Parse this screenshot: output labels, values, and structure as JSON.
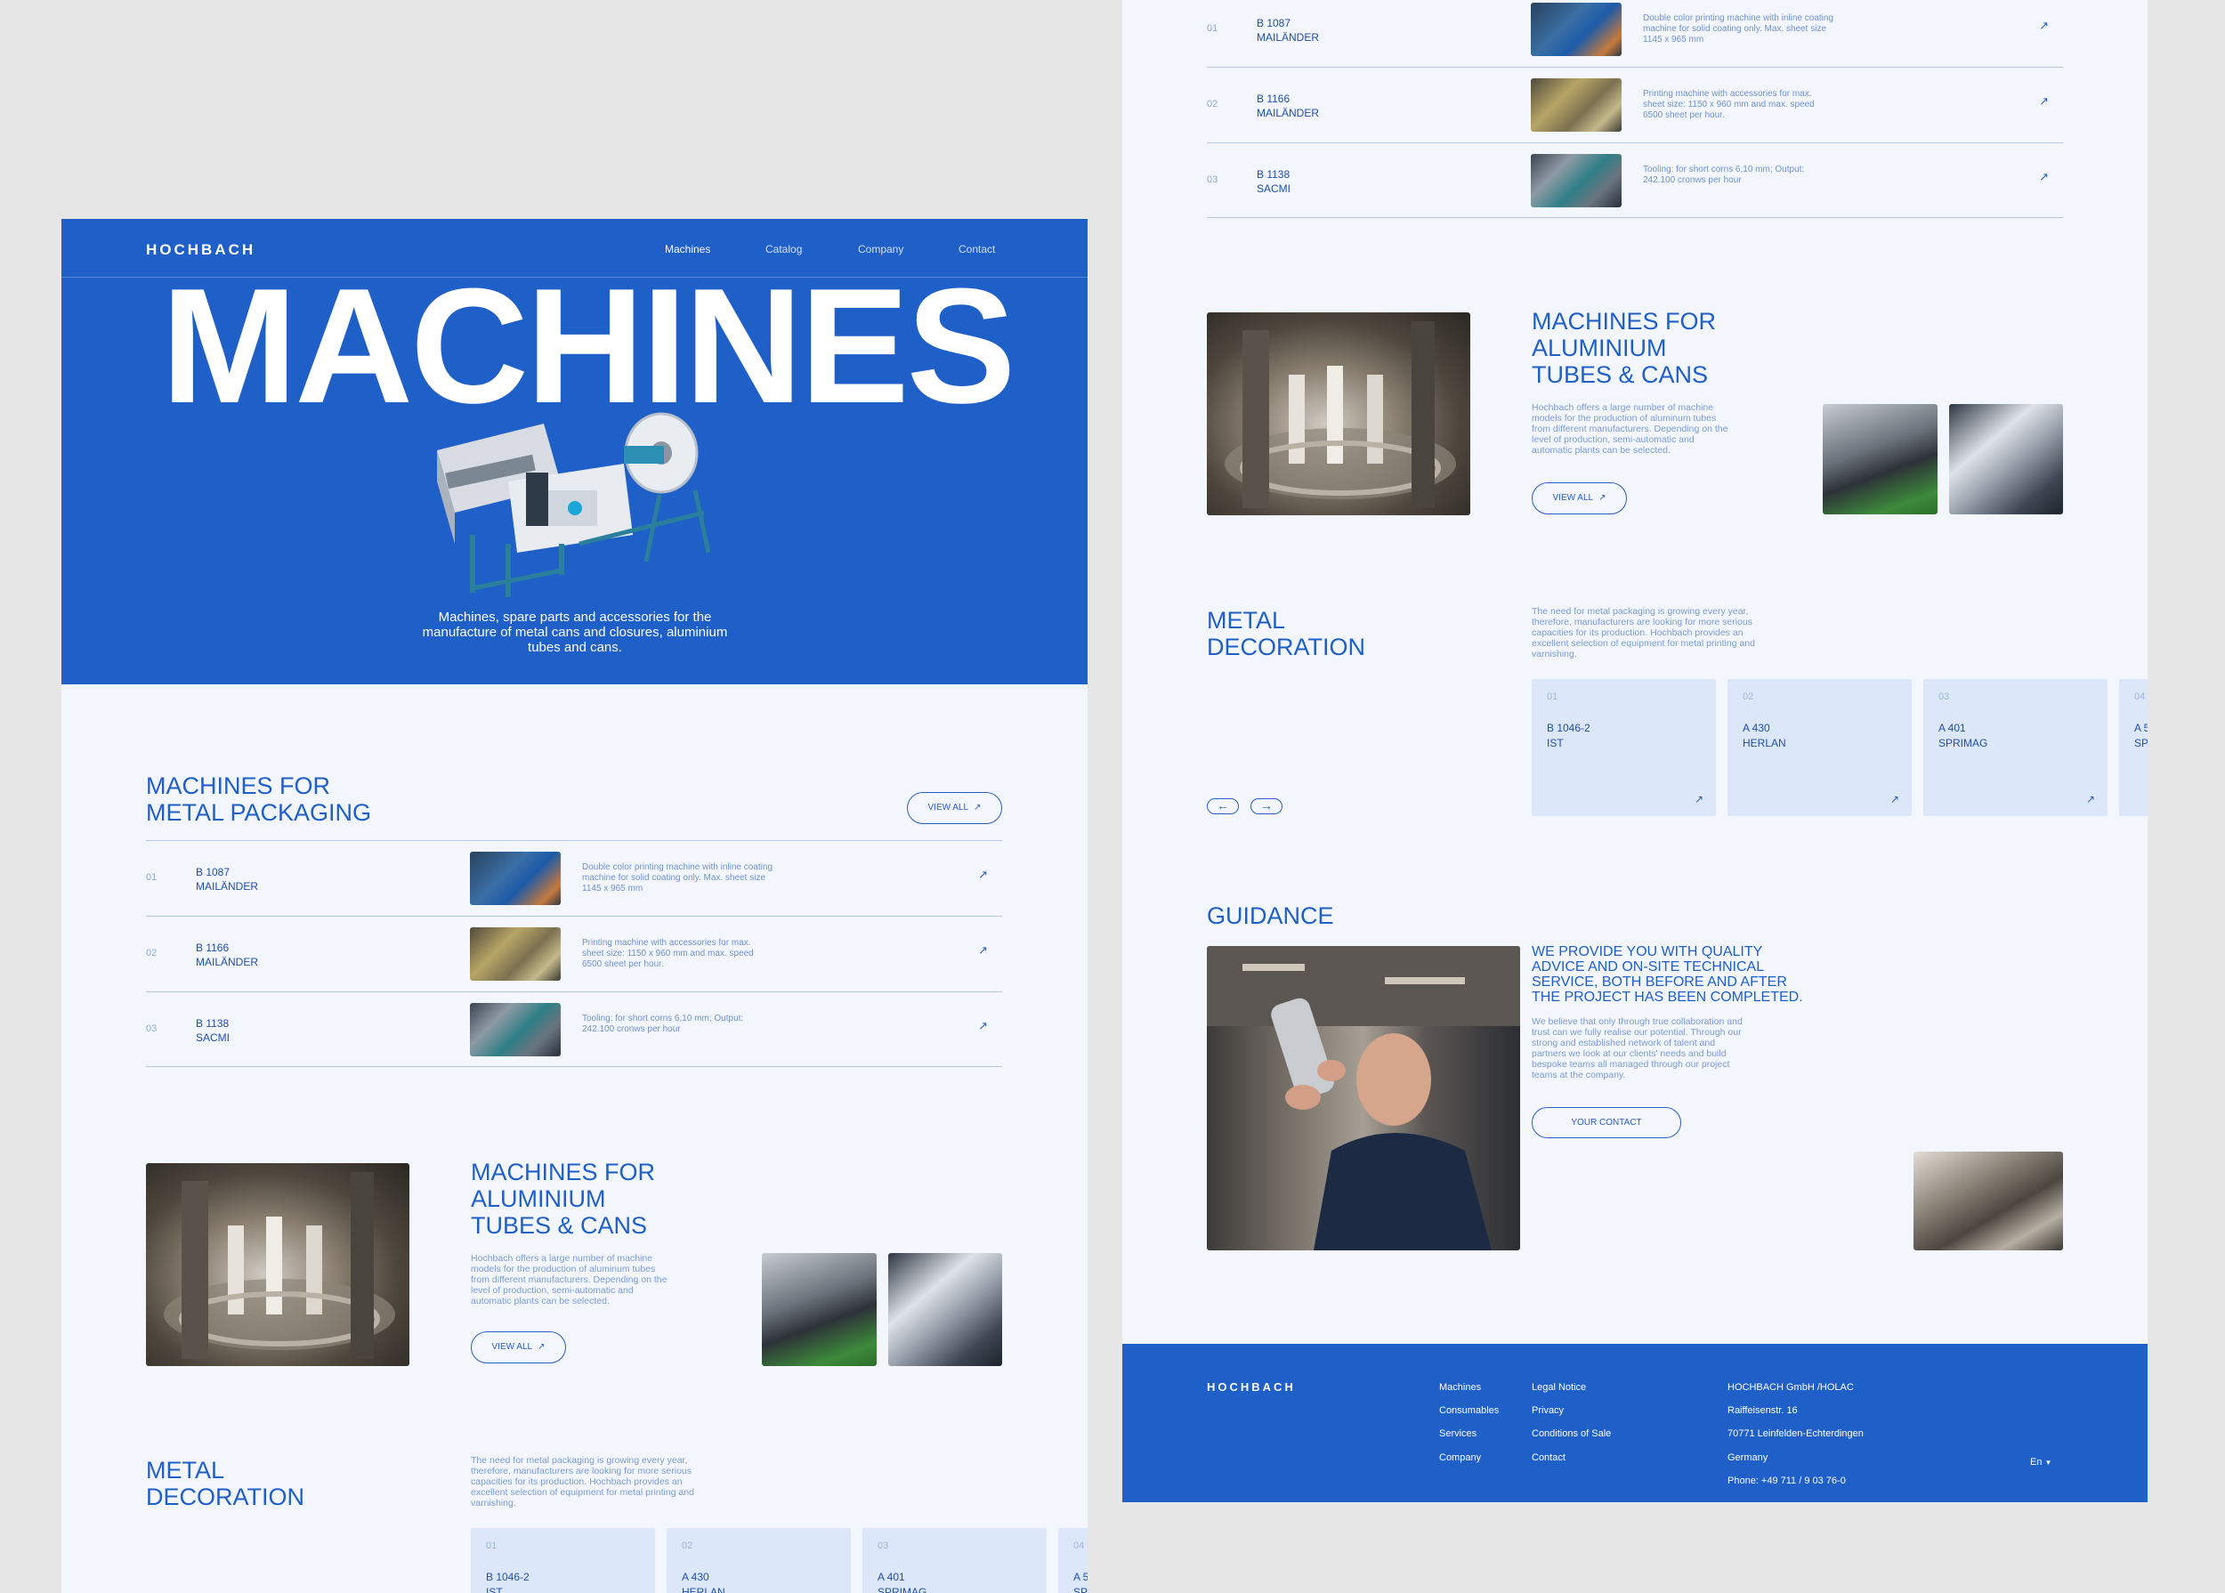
{
  "brand": "HOCHBACH",
  "nav": [
    "Machines",
    "Catalog",
    "Company",
    "Contact"
  ],
  "hero": {
    "title": "MACHINES",
    "subtitle": "Machines, spare parts and accessories for the manufacture of metal cans and closures, aluminium tubes and cans."
  },
  "packaging": {
    "title_l1": "MACHINES FOR",
    "title_l2": "METAL PACKAGING",
    "view_all": "VIEW ALL",
    "rows": [
      {
        "num": "01",
        "code": "B 1087",
        "maker": "MAILÄNDER",
        "desc": "Double color printing machine with inline coating machine for solid coating only. Max. sheet size 1145 x 965 mm"
      },
      {
        "num": "02",
        "code": "B 1166",
        "maker": "MAILÄNDER",
        "desc": "Printing machine with accessories for max. sheet size: 1150 x 960 mm and max. speed 6500 sheet per hour."
      },
      {
        "num": "03",
        "code": "B 1138",
        "maker": "SACMI",
        "desc": "Tooling: for short corns 6,10 mm; Output: 242.100 cronws per hour"
      }
    ]
  },
  "tubes": {
    "title_l1": "MACHINES FOR",
    "title_l2": "ALUMINIUM",
    "title_l3": "TUBES & CANS",
    "desc": "Hochbach offers a large number of machine models for the production of aluminum tubes from different manufacturers. Depending on the level of production, semi-automatic and automatic plants can be selected.",
    "view_all": "VIEW ALL"
  },
  "decoration": {
    "title_l1": "METAL",
    "title_l2": "DECORATION",
    "desc": "The need for metal packaging is growing every year, therefore, manufacturers are looking for more serious capacities for its production. Hochbach provides an excellent selection of equipment for metal printing and varnishing.",
    "cards": [
      {
        "num": "01",
        "code": "B 1046-2",
        "maker": "IST"
      },
      {
        "num": "02",
        "code": "A 430",
        "maker": "HERLAN"
      },
      {
        "num": "03",
        "code": "A 401",
        "maker": "SPRIMAG"
      },
      {
        "num": "04",
        "code": "A 5",
        "maker": "SP"
      }
    ]
  },
  "guidance": {
    "title": "GUIDANCE",
    "headline": "WE PROVIDE YOU WITH QUALITY ADVICE AND ON-SITE TECHNICAL SERVICE, BOTH BEFORE AND AFTER THE PROJECT HAS BEEN COMPLETED.",
    "body": "We believe that only through true collaboration and trust can we fully realise our potential. Through our strong and established network of talent and partners we look at our clients' needs and build bespoke teams all managed through our project teams at the company.",
    "button": "YOUR CONTACT"
  },
  "footer": {
    "col1": [
      "Machines",
      "Consumables",
      "Services",
      "Company"
    ],
    "col2": [
      "Legal Notice",
      "Privacy",
      "Conditions of Sale",
      "Contact"
    ],
    "address": [
      "HOCHBACH GmbH /HOLAC",
      "Raiffeisenstr. 16",
      "70771 Leinfelden-Echterdingen",
      "Germany",
      "Phone: +49 711 / 9 03 76-0"
    ],
    "lang": "En"
  },
  "colors": {
    "brand_blue": "#1f5fc8",
    "page_bg": "#f3f7fd",
    "card_bg": "#dce8fa"
  }
}
